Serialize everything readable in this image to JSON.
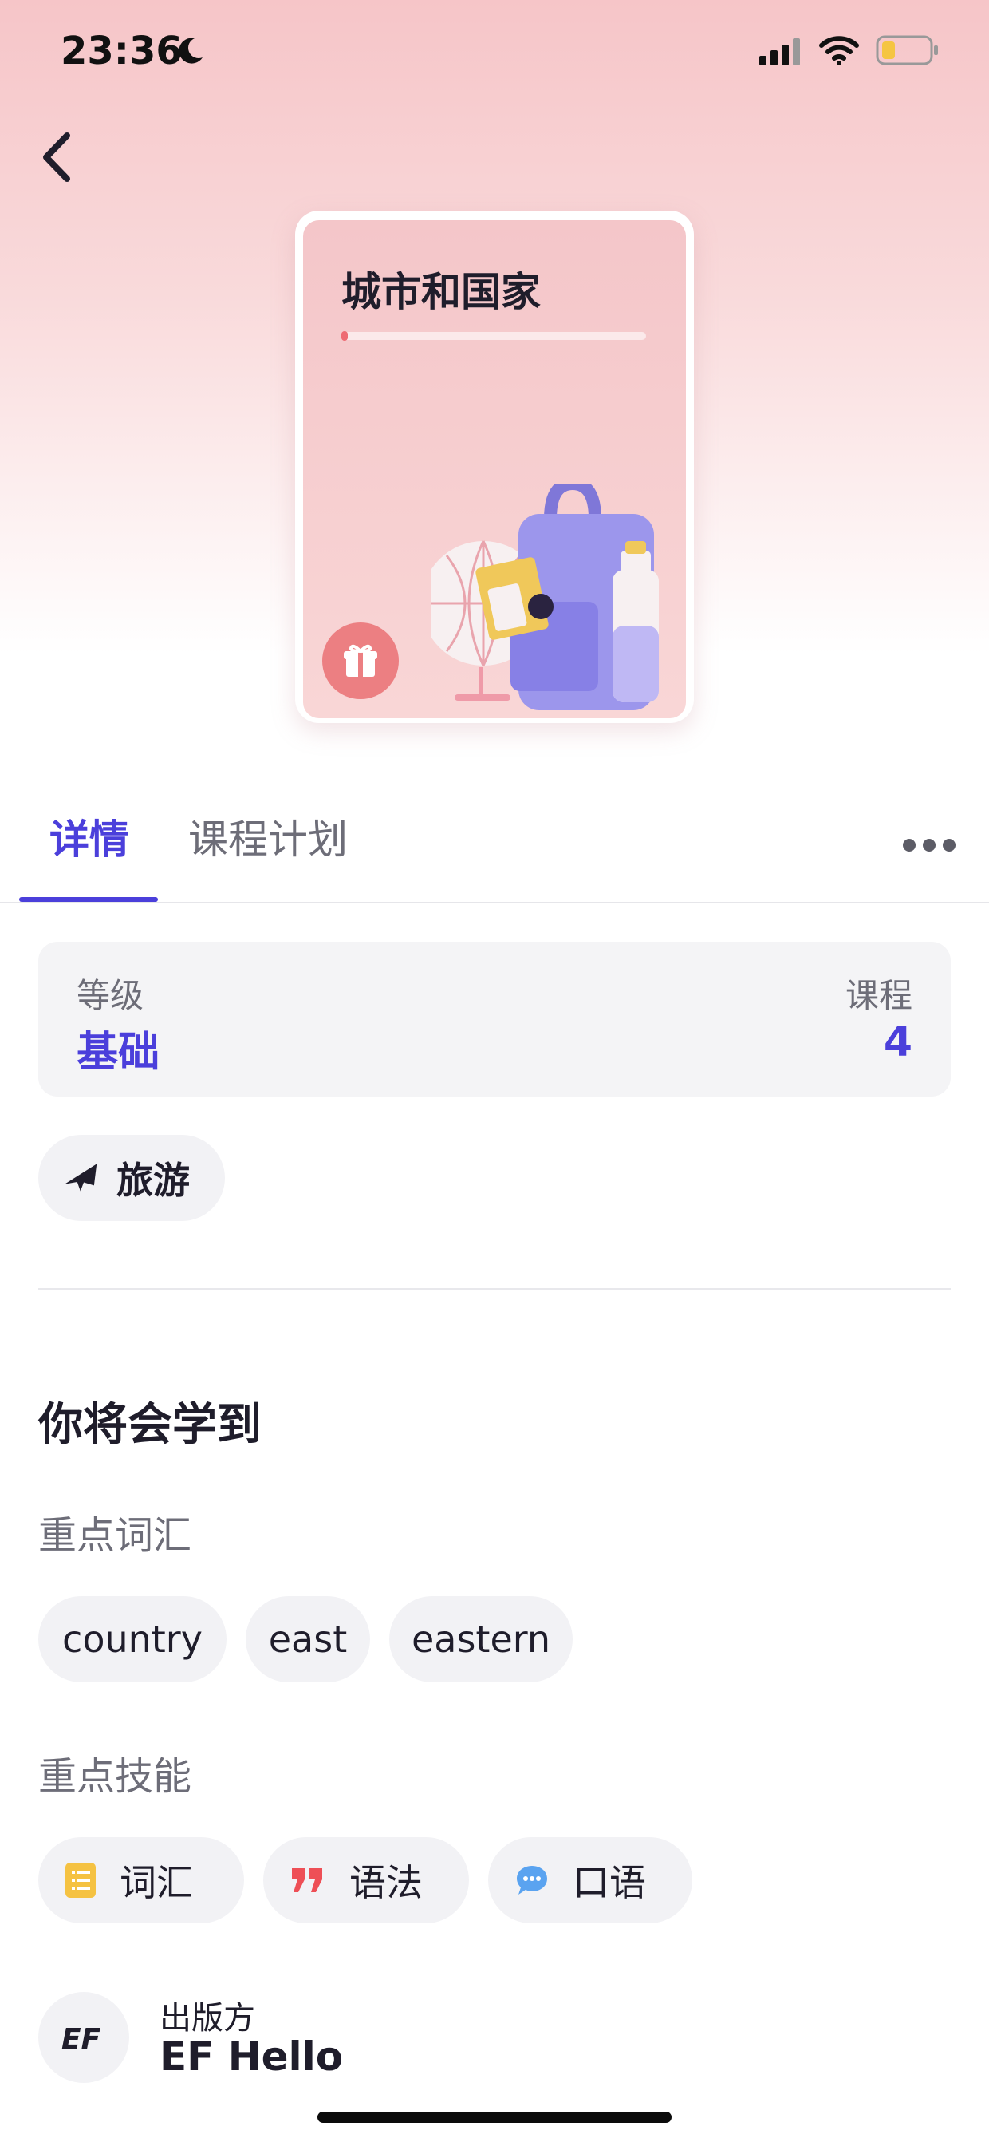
{
  "status_bar": {
    "time": "23:36"
  },
  "course": {
    "title": "城市和国家",
    "progress_percent": 2
  },
  "tabs": [
    {
      "label": "详情",
      "active": true
    },
    {
      "label": "课程计划",
      "active": false
    }
  ],
  "info": {
    "level_label": "等级",
    "level_value": "基础",
    "lessons_label": "课程",
    "lessons_value": "4"
  },
  "topic": {
    "icon": "airplane-icon",
    "label": "旅游"
  },
  "learn": {
    "title": "你将会学到",
    "vocab_label": "重点词汇",
    "words": [
      "country",
      "east",
      "eastern"
    ],
    "skills_label": "重点技能",
    "skills": [
      {
        "label": "词汇",
        "icon": "vocabulary-icon"
      },
      {
        "label": "语法",
        "icon": "quote-icon"
      },
      {
        "label": "口语",
        "icon": "chat-bubble-icon"
      }
    ]
  },
  "publisher": {
    "label": "出版方",
    "name": "EF Hello",
    "logo_text": "EF"
  },
  "colors": {
    "accent": "#4b3fdb",
    "progress": "#ee6b73",
    "gift_badge": "#ec7f82",
    "vocab_icon": "#f5c242",
    "grammar_icon": "#ee4f56",
    "speaking_icon": "#5aa3f0"
  }
}
